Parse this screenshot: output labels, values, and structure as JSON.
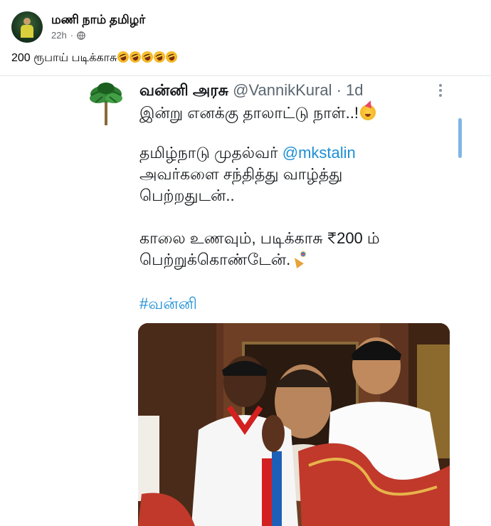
{
  "post": {
    "author": "மணி நாம் தமிழர்",
    "time": "22h",
    "dot": "·",
    "caption": "200 ரூபாய் படிக்காசு",
    "caption_emoji": [
      "rolling-on-floor-laughing-icon",
      "rolling-on-floor-laughing-icon",
      "rolling-on-floor-laughing-icon",
      "rolling-on-floor-laughing-icon",
      "rolling-on-floor-laughing-icon"
    ]
  },
  "tweet": {
    "name": "வன்னி அரசு",
    "handle": "@VannikKural · 1d",
    "line1": "இன்று எனக்கு தாலாட்டு நாள்..!",
    "line2_prefix": "தமிழ்நாடு முதல்வர் ",
    "line2_mention": "@mkstalin",
    "line3": "அவர்களை சந்தித்து வாழ்த்து",
    "line4": "பெற்றதுடன்..",
    "line5": "காலை உணவும், படிக்காசு ₹200 ம்",
    "line6": "பெற்றுக்கொண்டேன்.",
    "hashtag": "#வன்னி"
  },
  "colors": {
    "link_blue": "#1d8fd6",
    "meta_gray": "#65676b",
    "handle_gray": "#5b6670",
    "scrollbar": "#7fb6e6"
  },
  "icons": {
    "privacy": "globe-icon",
    "tweet_menu": "more-vertical-icon",
    "line1_emoji": "partying-face-icon",
    "line6_emoji": "party-popper-icon"
  }
}
